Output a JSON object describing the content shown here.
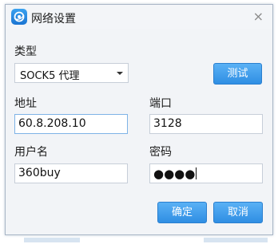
{
  "window": {
    "title": "网络设置",
    "close_glyph": "×",
    "icon": "app-logo-icon"
  },
  "form": {
    "type_label": "类型",
    "type_value": "SOCK5 代理",
    "test_button": "测试",
    "address_label": "地址",
    "address_value": "60.8.208.10",
    "port_label": "端口",
    "port_value": "3128",
    "username_label": "用户名",
    "username_value": "360buy",
    "password_label": "密码",
    "password_value": "●●●●"
  },
  "actions": {
    "ok_label": "确定",
    "cancel_label": "取消"
  },
  "colors": {
    "button": "#3d9bea",
    "dialog_bg": "#eef0f3",
    "focus_border": "#7eb3e6"
  }
}
